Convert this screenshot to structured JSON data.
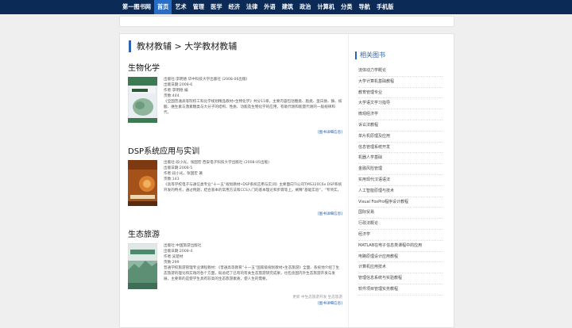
{
  "nav": [
    "第一图书网",
    "首页",
    "艺术",
    "管理",
    "医学",
    "经济",
    "法律",
    "外语",
    "建筑",
    "政治",
    "计算机",
    "分类",
    "导航",
    "手机版"
  ],
  "crumb": "教材教辅 > 大学教材教辅",
  "books": [
    {
      "title": "生物化学",
      "lines": [
        "出版社:李明德 华中科技大学出版社 (2008-06出版)",
        "出版日期:2008-6",
        "作者:李明德 编",
        "页数:444"
      ],
      "desc": "《全国普通高等院校工科化学规划精品教材•生物化学》共分11章，主要内容包括糖类、脂类、蛋白质、酶、核酸、维生素与激素糖类与大分子的结构、性质、功能及生物化学的应用，有助代谢和能量代谢的一般规律和代。",
      "more": "[图书详细信息]"
    },
    {
      "title": "DSP系统应用与实训",
      "lines": [
        "出版社:段小光，张国宏 西安电子科技大学出版社 (2008-05出版)",
        "出版日期:2008-5",
        "作者:段小光，张国宏 著",
        "页数:143"
      ],
      "desc": "《高等学校电子与通信类专业“十一五”规划教材•DSP系统应用与实训》主要面向TI公司TMS320C6x DSP系统开发的特点，通过例题，结合基本的常用方法和CCS入门的基本理论和步骤等上，阐释“基础实验”，“专项实。",
      "more": "[图书详细信息]"
    },
    {
      "title": "生态旅游",
      "lines": [
        "出版社:中国旅游出版社",
        "出版日期:2008-4",
        "作者:吴楚材",
        "页数:299"
      ],
      "desc": "普通学校旅游管理专业课程教材：《普通高等教育“十一五”国家级规划教材•生态旅游》全面、系统地介绍了生态旅游的理论和实践的各个方面，既总结了已有的有关生态旅游研究成果，也包含国内外生态旅游开发与发展，主要目的是使学生具有较高的生态旅游素质，使人生的需要。",
      "extra": "更新 中生态旅游开发 生态旅游",
      "more": "[图书详细信息]"
    }
  ],
  "related_title": "相关图书",
  "related": [
    "流体动力学概论",
    "大学计算机基础教程",
    "教育管理专业",
    "大学语文学习指导",
    "微观经济学",
    "诉讼法教程",
    "单片机原理及应用",
    "信息管理系统开发",
    "机器人学基础",
    "金融风险管理",
    "实用现代汉语语法",
    "人工智能原理与技术",
    "Visual FoxPro程序设计教程",
    "国际贸易",
    "行政法概论",
    "经济学",
    "MATLAB在电子信息类课程中的应用",
    "电路原理设计应用教程",
    "计算机应用技术",
    "管理信息系统与实验教程",
    "软件项目管理实务教程"
  ]
}
